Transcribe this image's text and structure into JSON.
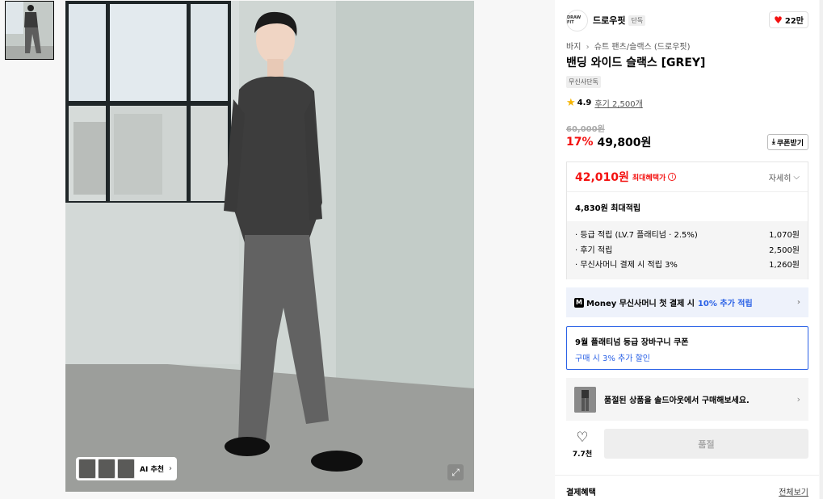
{
  "gallery": {
    "thumbnail_icon": "model-photo-thumbnail",
    "expand_icon": "expand-icon",
    "ai_label": "AI 추천",
    "ai_chevron": "›"
  },
  "brand": {
    "logo_text": "DRAW FIT",
    "name": "드로우핏",
    "tag": "단독",
    "likes": "22만",
    "heart": "♥"
  },
  "product": {
    "breadcrumb": [
      "바지",
      "슈트 팬츠/슬랙스 (드로우핏)"
    ],
    "breadcrumb_sep": "›",
    "title": "밴딩 와이드 슬랙스 [GREY]",
    "exclusive_tag": "무신사단독",
    "star": "★",
    "rating": "4.9",
    "reviews": "후기 2,500개",
    "original_price": "60,000원",
    "discount": "17%",
    "price": "49,800원",
    "coupon_button": "쿠폰받기",
    "coupon_icon": "⤓"
  },
  "benefit": {
    "max_price": "42,010원",
    "max_label": "최대혜택가",
    "info_icon": "i",
    "detail_toggle": "자세히",
    "detail_chevron": "⌵",
    "points_head": "4,830원 최대적립",
    "points": [
      {
        "label": "· 등급 적립 (LV.7 플래티넘 · 2.5%)",
        "value": "1,070원"
      },
      {
        "label": "· 후기 적립",
        "value": "2,500원"
      },
      {
        "label": "· 무신사머니 결제 시 적립 3%",
        "value": "1,260원"
      }
    ]
  },
  "money_banner": {
    "badge": "M",
    "text": "Money 무신사머니 첫 결제 시",
    "highlight": "10% 추가 적립",
    "chevron": "›"
  },
  "coupon_box": {
    "title": "9월 플래티넘 등급 장바구니 쿠폰",
    "subtitle": "구매 시 3% 추가 할인"
  },
  "soldout_banner": {
    "text": "품절된 상품을 솔드아웃에서 구매해보세요.",
    "chevron": "›"
  },
  "actions": {
    "heart": "♡",
    "like_count": "7.7천",
    "buy_label": "품절"
  },
  "payment": {
    "title": "결제혜택",
    "view_all": "전체보기"
  },
  "colors": {
    "sale_red": "#f31110",
    "accent_blue": "#2a61e6"
  }
}
